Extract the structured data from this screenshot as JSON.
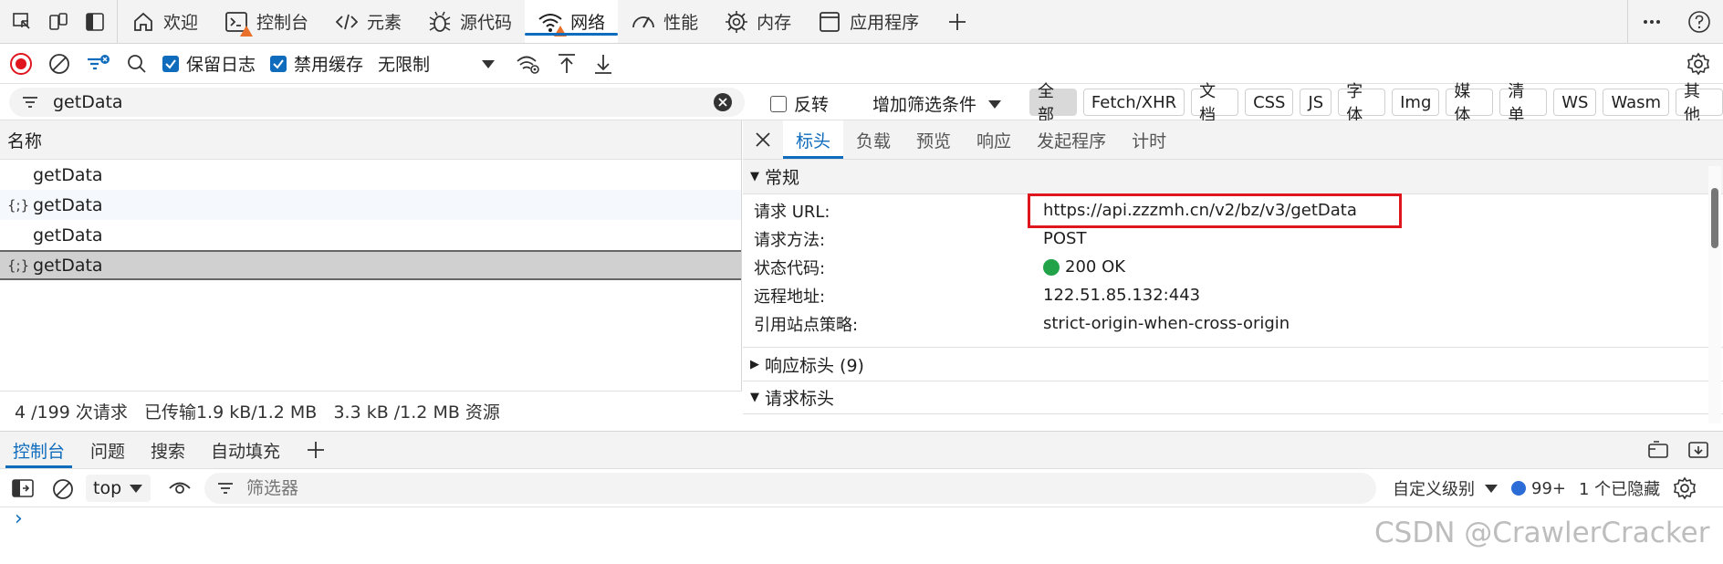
{
  "topbar": {
    "tabs": [
      {
        "label": "欢迎",
        "icon": "home-icon"
      },
      {
        "label": "控制台",
        "icon": "console-icon"
      },
      {
        "label": "元素",
        "icon": "code-icon"
      },
      {
        "label": "源代码",
        "icon": "bug-icon"
      },
      {
        "label": "网络",
        "icon": "wifi-icon"
      },
      {
        "label": "性能",
        "icon": "gauge-icon"
      },
      {
        "label": "内存",
        "icon": "chip-icon"
      },
      {
        "label": "应用程序",
        "icon": "app-icon"
      }
    ],
    "active_tab": "网络"
  },
  "toolbar": {
    "preserve_log": "保留日志",
    "disable_cache": "禁用缓存",
    "throttling": "无限制"
  },
  "filter": {
    "value": "getData",
    "invert": "反转",
    "more_filters": "增加筛选条件",
    "types": [
      "全部",
      "Fetch/XHR",
      "文档",
      "CSS",
      "JS",
      "字体",
      "Img",
      "媒体",
      "清单",
      "WS",
      "Wasm",
      "其他"
    ],
    "active_type": "全部"
  },
  "requests": {
    "header": "名称",
    "rows": [
      {
        "name": "getData",
        "icon": ""
      },
      {
        "name": "getData",
        "icon": "{;}"
      },
      {
        "name": "getData",
        "icon": ""
      },
      {
        "name": "getData",
        "icon": "{;}"
      }
    ],
    "summary": "4 /199 次请求   已传输1.9 kB/1.2 MB   3.3 kB /1.2 MB 资源"
  },
  "detail": {
    "tabs": [
      "标头",
      "负载",
      "预览",
      "响应",
      "发起程序",
      "计时"
    ],
    "active_tab": "标头",
    "general_title": "常规",
    "general": [
      {
        "key": "请求 URL:",
        "value": "https://api.zzzmh.cn/v2/bz/v3/getData"
      },
      {
        "key": "请求方法:",
        "value": "POST"
      },
      {
        "key": "状态代码:",
        "value": "200 OK"
      },
      {
        "key": "远程地址:",
        "value": "122.51.85.132:443"
      },
      {
        "key": "引用站点策略:",
        "value": "strict-origin-when-cross-origin"
      }
    ],
    "response_headers": "响应标头 (9)",
    "request_headers": "请求标头"
  },
  "drawer": {
    "tabs": [
      "控制台",
      "问题",
      "搜索",
      "自动填充"
    ],
    "active_tab": "控制台",
    "context": "top",
    "filter_placeholder": "筛选器",
    "levels": "自定义级别",
    "message_count": "99+",
    "hidden": "1 个已隐藏"
  },
  "watermark": "CSDN @CrawlerCracker",
  "colors": {
    "accent": "#0f6cbd",
    "highlight_box": "#e0161f",
    "status_ok": "#22a34a",
    "warning": "#e8702a"
  }
}
